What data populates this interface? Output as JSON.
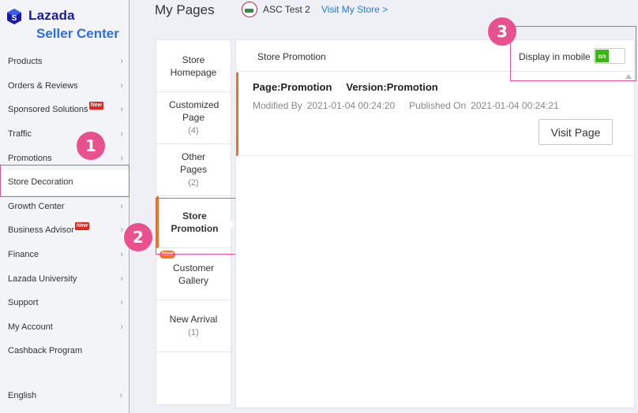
{
  "app": {
    "brand": "Lazada",
    "product": "Seller Center"
  },
  "sidebar": {
    "items": [
      {
        "label": "Products",
        "chevron": true,
        "new": false
      },
      {
        "label": "Orders & Reviews",
        "chevron": true,
        "new": false
      },
      {
        "label": "Sponsored Solutions",
        "chevron": true,
        "new": true
      },
      {
        "label": "Traffic",
        "chevron": true,
        "new": false
      },
      {
        "label": "Promotions",
        "chevron": true,
        "new": false
      },
      {
        "label": "Store Decoration",
        "chevron": false,
        "new": false
      },
      {
        "label": "Growth Center",
        "chevron": true,
        "new": false
      },
      {
        "label": "Business Advisor",
        "chevron": true,
        "new": true
      },
      {
        "label": "Finance",
        "chevron": true,
        "new": false
      },
      {
        "label": "Lazada University",
        "chevron": true,
        "new": false
      },
      {
        "label": "Support",
        "chevron": true,
        "new": false
      },
      {
        "label": "My Account",
        "chevron": true,
        "new": false
      },
      {
        "label": "Cashback Program",
        "chevron": false,
        "new": false
      }
    ],
    "new_badge": "New",
    "chevron_glyph": "›",
    "language": "English"
  },
  "header": {
    "title": "My Pages",
    "store_name": "ASC Test 2",
    "visit_store": "Visit My Store >"
  },
  "tabs": [
    {
      "name": "store-homepage",
      "label": "Store Homepage",
      "count": "",
      "active": false,
      "new": false
    },
    {
      "name": "customized-page",
      "label": "Customized Page",
      "count": "(4)",
      "active": false,
      "new": false
    },
    {
      "name": "other-pages",
      "label": "Other Pages",
      "count": "(2)",
      "active": false,
      "new": false
    },
    {
      "name": "store-promotion",
      "label": "Store Promotion",
      "count": "",
      "active": true,
      "new": false
    },
    {
      "name": "customer-gallery",
      "label": "Customer Gallery",
      "count": "",
      "active": false,
      "new": true
    },
    {
      "name": "new-arrival",
      "label": "New Arrival",
      "count": "(1)",
      "active": false,
      "new": false
    }
  ],
  "tab_new_badge": "New",
  "panel": {
    "title": "Store Promotion",
    "display_mobile_label": "Display in mobile",
    "toggle_label": "on",
    "toggle_state": true
  },
  "page_card": {
    "page": "Page:Promotion",
    "version": "Version:Promotion",
    "modified_by_label": "Modified By",
    "modified_at": "2021-01-04 00:24:20",
    "published_on_label": "Published On",
    "published_at": "2021-01-04 00:24:21",
    "visit_button": "Visit Page"
  },
  "markers": [
    "1",
    "2",
    "3"
  ],
  "colors": {
    "accent": "#f57224",
    "highlight": "#e8508e",
    "link": "#1a7de0",
    "toggle_on": "#3cb517",
    "brand": "#1a1aa6"
  }
}
